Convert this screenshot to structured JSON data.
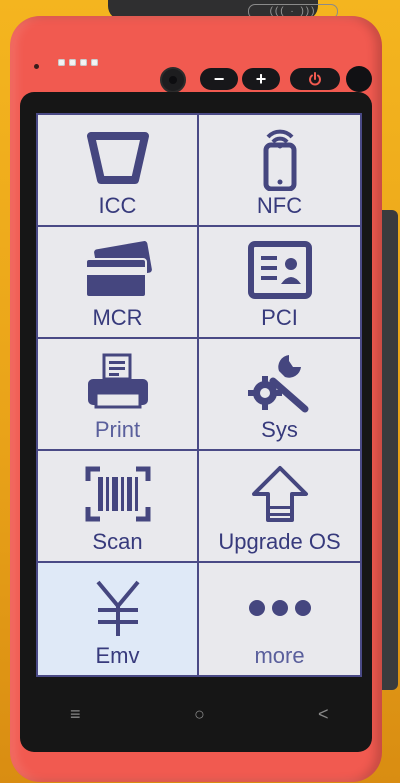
{
  "device": {
    "top_logo": "((( · )))",
    "buttons": {
      "volume_down": "−",
      "volume_up": "+",
      "power_icon": "power-icon"
    }
  },
  "colors": {
    "casing": "#f15a50",
    "accent": "#4a4a86",
    "label": "#373a7c",
    "background": "#f4b51f"
  },
  "apps": [
    {
      "label": "ICC",
      "icon": "chip-card-icon"
    },
    {
      "label": "NFC",
      "icon": "nfc-phone-icon"
    },
    {
      "label": "MCR",
      "icon": "magnetic-card-icon"
    },
    {
      "label": "PCI",
      "icon": "id-card-icon"
    },
    {
      "label": "Print",
      "icon": "printer-icon"
    },
    {
      "label": "Sys",
      "icon": "settings-tools-icon"
    },
    {
      "label": "Scan",
      "icon": "barcode-scan-icon"
    },
    {
      "label": "Upgrade OS",
      "icon": "upgrade-arrow-icon"
    },
    {
      "label": "Emv",
      "icon": "yuan-icon"
    },
    {
      "label": "more",
      "icon": "more-dots-icon"
    }
  ],
  "navbar": {
    "menu": "≡",
    "home": "○",
    "back": "<"
  }
}
